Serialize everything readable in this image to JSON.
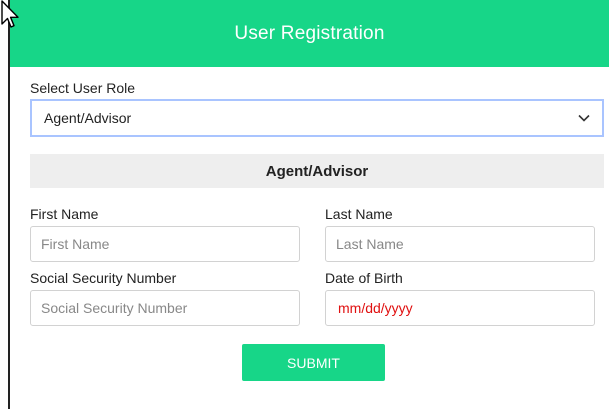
{
  "header": {
    "title": "User Registration"
  },
  "role": {
    "label": "Select User Role",
    "selected": "Agent/Advisor"
  },
  "section": {
    "title": "Agent/Advisor"
  },
  "fields": {
    "first_name": {
      "label": "First Name",
      "placeholder": "First Name"
    },
    "last_name": {
      "label": "Last Name",
      "placeholder": "Last Name"
    },
    "ssn": {
      "label": "Social Security Number",
      "placeholder": "Social Security Number"
    },
    "dob": {
      "label": "Date of Birth",
      "placeholder": "mm/dd/yyyy"
    }
  },
  "submit": {
    "label": "SUBMIT"
  },
  "colors": {
    "accent": "#17d688",
    "select_border": "#a9c4ff",
    "date_text": "#e01010",
    "section_bg": "#eeeeee"
  }
}
